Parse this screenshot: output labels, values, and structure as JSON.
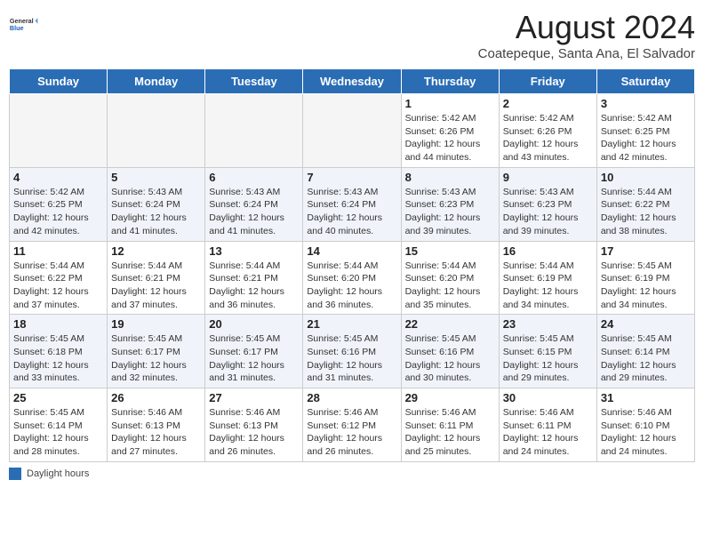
{
  "logo": {
    "line1": "General",
    "line2": "Blue"
  },
  "title": "August 2024",
  "subtitle": "Coatepeque, Santa Ana, El Salvador",
  "days_of_week": [
    "Sunday",
    "Monday",
    "Tuesday",
    "Wednesday",
    "Thursday",
    "Friday",
    "Saturday"
  ],
  "legend_label": "Daylight hours",
  "weeks": [
    [
      {
        "num": "",
        "info": ""
      },
      {
        "num": "",
        "info": ""
      },
      {
        "num": "",
        "info": ""
      },
      {
        "num": "",
        "info": ""
      },
      {
        "num": "1",
        "info": "Sunrise: 5:42 AM\nSunset: 6:26 PM\nDaylight: 12 hours and 44 minutes."
      },
      {
        "num": "2",
        "info": "Sunrise: 5:42 AM\nSunset: 6:26 PM\nDaylight: 12 hours and 43 minutes."
      },
      {
        "num": "3",
        "info": "Sunrise: 5:42 AM\nSunset: 6:25 PM\nDaylight: 12 hours and 42 minutes."
      }
    ],
    [
      {
        "num": "4",
        "info": "Sunrise: 5:42 AM\nSunset: 6:25 PM\nDaylight: 12 hours and 42 minutes."
      },
      {
        "num": "5",
        "info": "Sunrise: 5:43 AM\nSunset: 6:24 PM\nDaylight: 12 hours and 41 minutes."
      },
      {
        "num": "6",
        "info": "Sunrise: 5:43 AM\nSunset: 6:24 PM\nDaylight: 12 hours and 41 minutes."
      },
      {
        "num": "7",
        "info": "Sunrise: 5:43 AM\nSunset: 6:24 PM\nDaylight: 12 hours and 40 minutes."
      },
      {
        "num": "8",
        "info": "Sunrise: 5:43 AM\nSunset: 6:23 PM\nDaylight: 12 hours and 39 minutes."
      },
      {
        "num": "9",
        "info": "Sunrise: 5:43 AM\nSunset: 6:23 PM\nDaylight: 12 hours and 39 minutes."
      },
      {
        "num": "10",
        "info": "Sunrise: 5:44 AM\nSunset: 6:22 PM\nDaylight: 12 hours and 38 minutes."
      }
    ],
    [
      {
        "num": "11",
        "info": "Sunrise: 5:44 AM\nSunset: 6:22 PM\nDaylight: 12 hours and 37 minutes."
      },
      {
        "num": "12",
        "info": "Sunrise: 5:44 AM\nSunset: 6:21 PM\nDaylight: 12 hours and 37 minutes."
      },
      {
        "num": "13",
        "info": "Sunrise: 5:44 AM\nSunset: 6:21 PM\nDaylight: 12 hours and 36 minutes."
      },
      {
        "num": "14",
        "info": "Sunrise: 5:44 AM\nSunset: 6:20 PM\nDaylight: 12 hours and 36 minutes."
      },
      {
        "num": "15",
        "info": "Sunrise: 5:44 AM\nSunset: 6:20 PM\nDaylight: 12 hours and 35 minutes."
      },
      {
        "num": "16",
        "info": "Sunrise: 5:44 AM\nSunset: 6:19 PM\nDaylight: 12 hours and 34 minutes."
      },
      {
        "num": "17",
        "info": "Sunrise: 5:45 AM\nSunset: 6:19 PM\nDaylight: 12 hours and 34 minutes."
      }
    ],
    [
      {
        "num": "18",
        "info": "Sunrise: 5:45 AM\nSunset: 6:18 PM\nDaylight: 12 hours and 33 minutes."
      },
      {
        "num": "19",
        "info": "Sunrise: 5:45 AM\nSunset: 6:17 PM\nDaylight: 12 hours and 32 minutes."
      },
      {
        "num": "20",
        "info": "Sunrise: 5:45 AM\nSunset: 6:17 PM\nDaylight: 12 hours and 31 minutes."
      },
      {
        "num": "21",
        "info": "Sunrise: 5:45 AM\nSunset: 6:16 PM\nDaylight: 12 hours and 31 minutes."
      },
      {
        "num": "22",
        "info": "Sunrise: 5:45 AM\nSunset: 6:16 PM\nDaylight: 12 hours and 30 minutes."
      },
      {
        "num": "23",
        "info": "Sunrise: 5:45 AM\nSunset: 6:15 PM\nDaylight: 12 hours and 29 minutes."
      },
      {
        "num": "24",
        "info": "Sunrise: 5:45 AM\nSunset: 6:14 PM\nDaylight: 12 hours and 29 minutes."
      }
    ],
    [
      {
        "num": "25",
        "info": "Sunrise: 5:45 AM\nSunset: 6:14 PM\nDaylight: 12 hours and 28 minutes."
      },
      {
        "num": "26",
        "info": "Sunrise: 5:46 AM\nSunset: 6:13 PM\nDaylight: 12 hours and 27 minutes."
      },
      {
        "num": "27",
        "info": "Sunrise: 5:46 AM\nSunset: 6:13 PM\nDaylight: 12 hours and 26 minutes."
      },
      {
        "num": "28",
        "info": "Sunrise: 5:46 AM\nSunset: 6:12 PM\nDaylight: 12 hours and 26 minutes."
      },
      {
        "num": "29",
        "info": "Sunrise: 5:46 AM\nSunset: 6:11 PM\nDaylight: 12 hours and 25 minutes."
      },
      {
        "num": "30",
        "info": "Sunrise: 5:46 AM\nSunset: 6:11 PM\nDaylight: 12 hours and 24 minutes."
      },
      {
        "num": "31",
        "info": "Sunrise: 5:46 AM\nSunset: 6:10 PM\nDaylight: 12 hours and 24 minutes."
      }
    ]
  ]
}
